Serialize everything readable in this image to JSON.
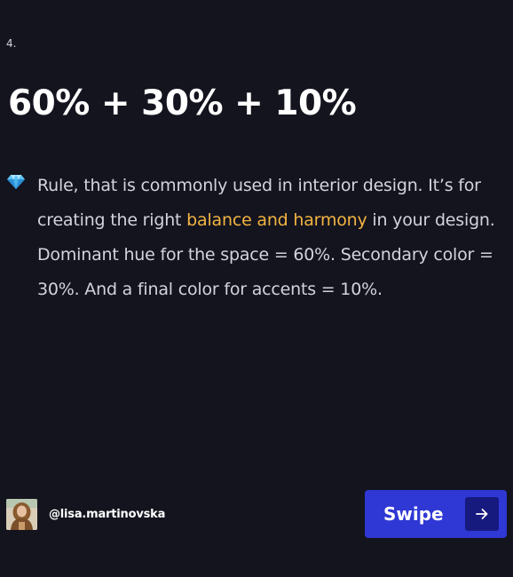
{
  "slide": {
    "number": "4."
  },
  "title": "60% + 30% + 10%",
  "body": {
    "icon": "gem-icon",
    "text_before": "Rule, that is commonly used in interior design. It’s for creating the right ",
    "highlight": "balance and harmony",
    "text_after": " in your design. Dominant hue for the space = 60%. Secondary color = 30%. And a final color for accents = 10%."
  },
  "author": {
    "handle": "@lisa.martinovska",
    "avatar_icon": "avatar-photo"
  },
  "cta": {
    "label": "Swipe",
    "icon": "arrow-right-icon"
  },
  "colors": {
    "background": "#14141f",
    "text": "#d3d3dc",
    "highlight": "#f3b441",
    "button": "#2f37d4",
    "button_arrow_box": "#161a7e"
  }
}
